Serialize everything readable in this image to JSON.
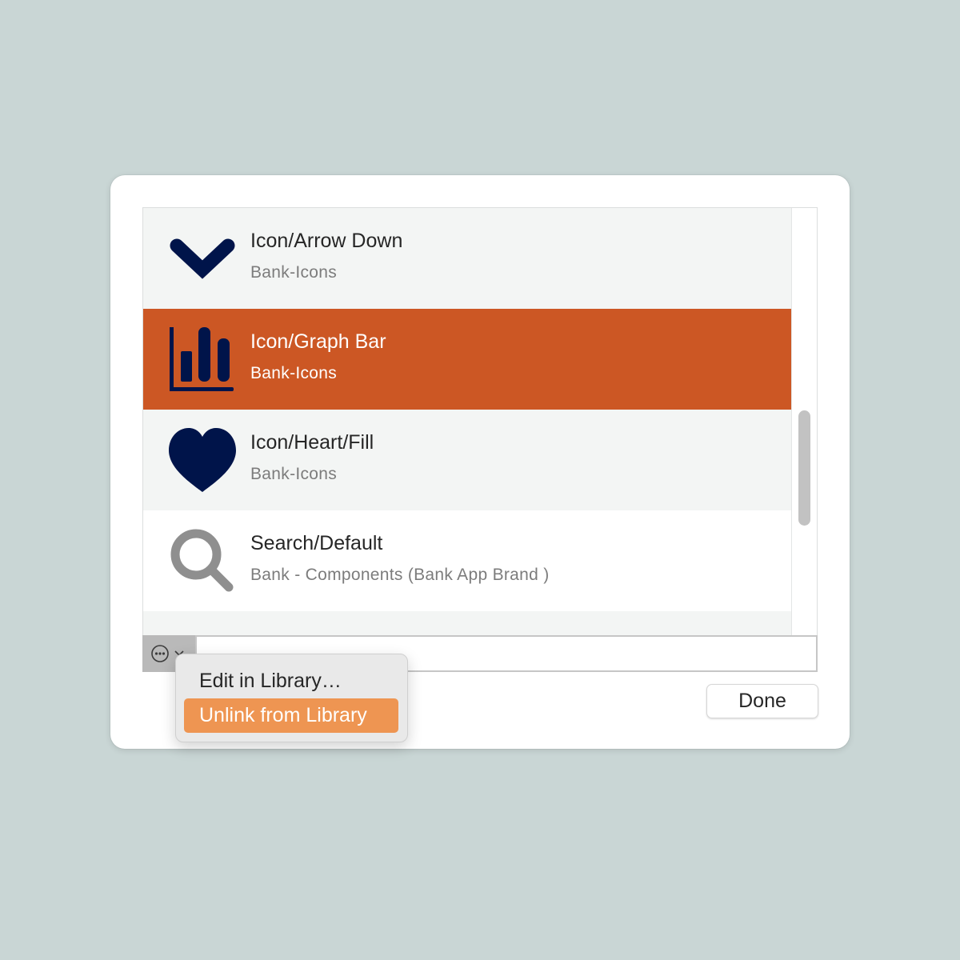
{
  "colors": {
    "background": "#c9d6d5",
    "selection": "#cc5724",
    "icon_navy": "#00144a",
    "icon_gray": "#8f8f8f",
    "menu_highlight": "#ee9552"
  },
  "list": {
    "items": [
      {
        "title": "Icon/Arrow Down",
        "subtitle": "Bank-Icons",
        "icon": "arrow-down-icon",
        "selected": false
      },
      {
        "title": "Icon/Graph Bar",
        "subtitle": "Bank-Icons",
        "icon": "graph-bar-icon",
        "selected": true
      },
      {
        "title": "Icon/Heart/Fill",
        "subtitle": "Bank-Icons",
        "icon": "heart-icon",
        "selected": false
      },
      {
        "title": "Search/Default",
        "subtitle": "Bank - Components (Bank App Brand )",
        "icon": "search-icon",
        "selected": false
      }
    ]
  },
  "bottom_bar": {
    "action_icon": "ellipsis-circle-icon",
    "chevron_icon": "chevron-down-icon"
  },
  "footer": {
    "done_label": "Done"
  },
  "context_menu": {
    "items": [
      {
        "label": "Edit in Library…",
        "highlighted": false
      },
      {
        "label": "Unlink from Library",
        "highlighted": true
      }
    ]
  }
}
